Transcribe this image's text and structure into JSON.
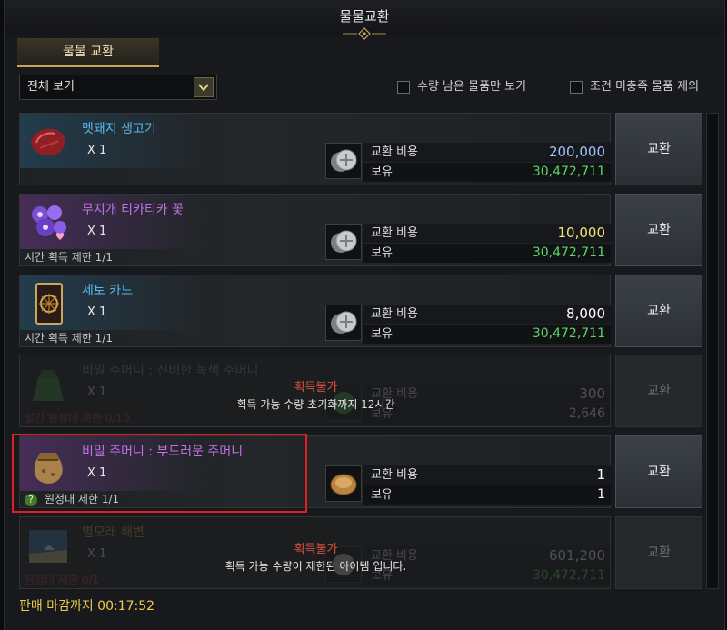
{
  "window": {
    "title": "물물교환"
  },
  "tab": {
    "label": "물물 교환"
  },
  "filter": {
    "selected": "전체 보기"
  },
  "checks": [
    {
      "label": "수량 남은 물품만 보기",
      "checked": false
    },
    {
      "label": "조건 미충족 물품 제외",
      "checked": false
    }
  ],
  "items": [
    {
      "name": "멧돼지 생고기",
      "qty": "X 1",
      "limit": "",
      "cost_label": "교환 비용",
      "cost": "200,000",
      "cost_color": "#9ec3ff",
      "own_label": "보유",
      "own": "30,472,711",
      "button": "교환",
      "icon": "meat-icon",
      "overlay_title": "",
      "overlay_text": ""
    },
    {
      "name": "무지개 티카티카 꽃",
      "qty": "X 1",
      "limit": "시간 획득 제한 1/1",
      "cost_label": "교환 비용",
      "cost": "10,000",
      "cost_color": "#f1e57a",
      "own_label": "보유",
      "own": "30,472,711",
      "button": "교환",
      "icon": "flower-icon",
      "overlay_title": "",
      "overlay_text": ""
    },
    {
      "name": "세토 카드",
      "qty": "X 1",
      "limit": "시간 획득 제한 1/1",
      "cost_label": "교환 비용",
      "cost": "8,000",
      "cost_color": "#ffffff",
      "own_label": "보유",
      "own": "30,472,711",
      "button": "교환",
      "icon": "card-icon",
      "overlay_title": "",
      "overlay_text": ""
    },
    {
      "name": "비밀 주머니 : 신비한 녹색 주머니",
      "qty": "X 1",
      "limit": "일간 원정대 제한 0/10",
      "cost_label": "교환 비용",
      "cost": "300",
      "cost_color": "#ffffff",
      "own_label": "보유",
      "own": "2,646",
      "button": "교환",
      "icon": "green-pouch-icon",
      "overlay_title": "획득불가",
      "overlay_text": "획득 가능 수량 초기화까지 12시간"
    },
    {
      "name": "비밀 주머니 : 부드러운 주머니",
      "qty": "X 1",
      "limit": "원정대 제한 1/1",
      "cost_label": "교환 비용",
      "cost": "1",
      "cost_color": "#ffffff",
      "own_label": "보유",
      "own": "1",
      "button": "교환",
      "icon": "pouch-icon",
      "overlay_title": "",
      "overlay_text": ""
    },
    {
      "name": "별모래 해변",
      "qty": "X 1",
      "limit": "원정대 제한 0/1",
      "cost_label": "교환 비용",
      "cost": "601,200",
      "cost_color": "#ffffff",
      "own_label": "보유",
      "own": "30,472,711",
      "button": "교환",
      "icon": "beach-icon",
      "overlay_title": "획득불가",
      "overlay_text": "획득 가능 수량이 제한된 아이템 입니다."
    }
  ],
  "footer": {
    "deadline": "판매 마감까지 00:17:52"
  },
  "colors": {
    "own_value": "#5fd26a",
    "accent": "#c9a65a",
    "selection": "#e02020"
  }
}
